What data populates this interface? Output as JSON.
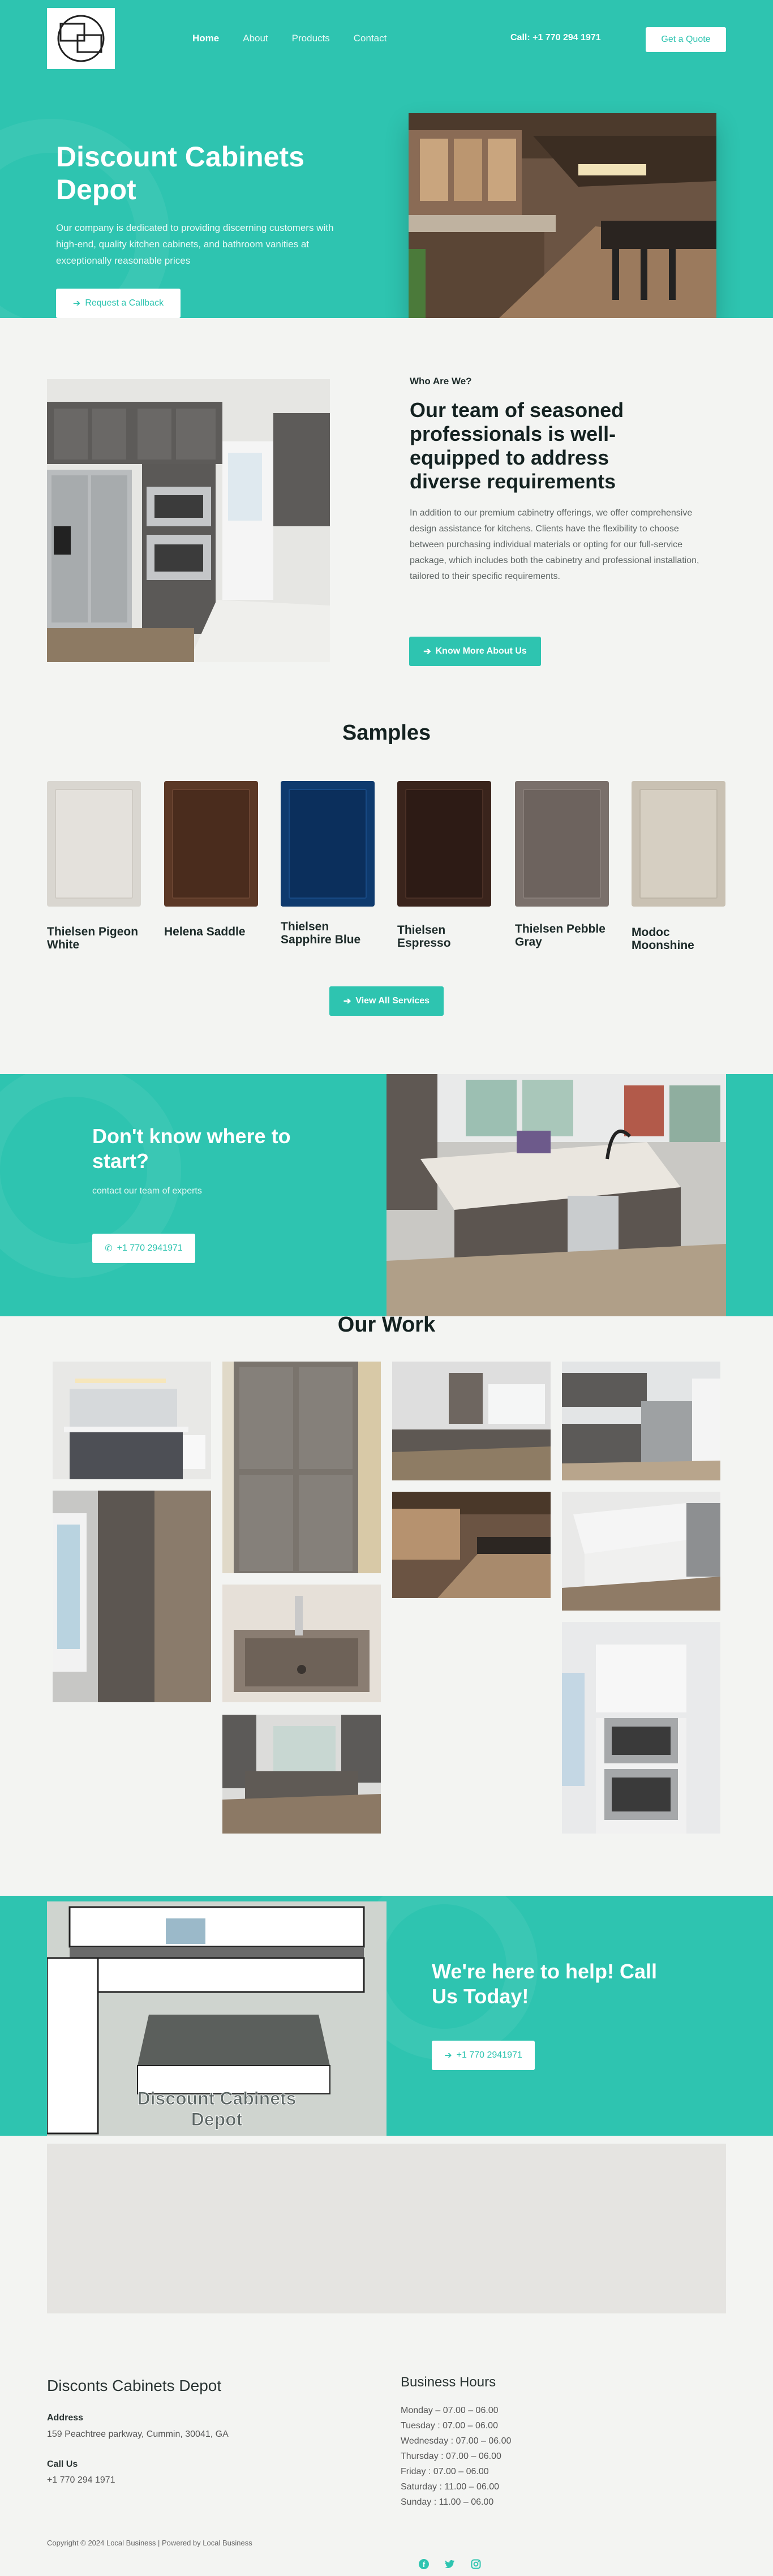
{
  "header": {
    "logo": "logo-mark",
    "nav": [
      "Home",
      "About",
      "Products",
      "Contact"
    ],
    "phone": "Call: +1 770 294 1971",
    "quote_button": "Get a Quote"
  },
  "hero": {
    "title_line1": "Discount Cabinets",
    "title_line2": "Depot",
    "description": "Our company is dedicated to providing discerning customers with high-end, quality kitchen cabinets, and bathroom vanities at exceptionally reasonable prices",
    "callback_button": "Request a Callback"
  },
  "about": {
    "eyebrow": "Who Are We?",
    "heading": "Our team of seasoned professionals is well-equipped to address diverse requirements",
    "body": "In addition to our premium cabinetry offerings, we offer comprehensive design assistance for kitchens. Clients have the flexibility to choose between purchasing individual materials or opting for our full-service package, which includes both the cabinetry and professional installation, tailored to their specific requirements.",
    "button": "Know More About Us"
  },
  "samples": {
    "title": "Samples",
    "items": [
      {
        "name": "Thielsen Pigeon White",
        "color": "#d9d6d0",
        "inner": "#e4e1dc"
      },
      {
        "name": "Helena Saddle",
        "color": "#5b3826",
        "inner": "#4a2c1d"
      },
      {
        "name": "Thielsen Sapphire Blue",
        "color": "#0e3a6e",
        "inner": "#0b2f5c"
      },
      {
        "name": "Thielsen Espresso",
        "color": "#3a241c",
        "inner": "#2d1b15"
      },
      {
        "name": "Thielsen Pebble Gray",
        "color": "#7a706b",
        "inner": "#6d635e"
      },
      {
        "name": "Modoc Moonshine",
        "color": "#c9c1b3",
        "inner": "#d6cfc2"
      }
    ],
    "button": "View All Services"
  },
  "cta1": {
    "title": "Don't know where to start?",
    "subtitle": "contact our team of experts",
    "phone_button": "+1 770 2941971"
  },
  "work": {
    "title": "Our Work"
  },
  "cta2": {
    "title": "We're here to help! Call Us Today!",
    "phone_button": "+1 770 2941971",
    "render_caption": "Discount Cabinets Depot"
  },
  "footer": {
    "company": "Disconts Cabinets Depot",
    "address_label": "Address",
    "address": "159 Peachtree parkway, Cummin, 30041, GA",
    "call_label": "Call Us",
    "phone": "+1 770 294 1971",
    "hours_title": "Business Hours",
    "hours": [
      "Monday – 07.00 – 06.00",
      "Tuesday : 07.00 – 06.00",
      "Wednesday : 07.00 – 06.00",
      "Thursday : 07.00 – 06.00",
      "Friday : 07.00 – 06.00",
      "Saturday : 11.00 – 06.00",
      "Sunday : 11.00 – 06.00"
    ],
    "copyright": "Copyright © 2024 Local Business | Powered by Local Business",
    "social": [
      "facebook-icon",
      "twitter-icon",
      "instagram-icon"
    ]
  }
}
